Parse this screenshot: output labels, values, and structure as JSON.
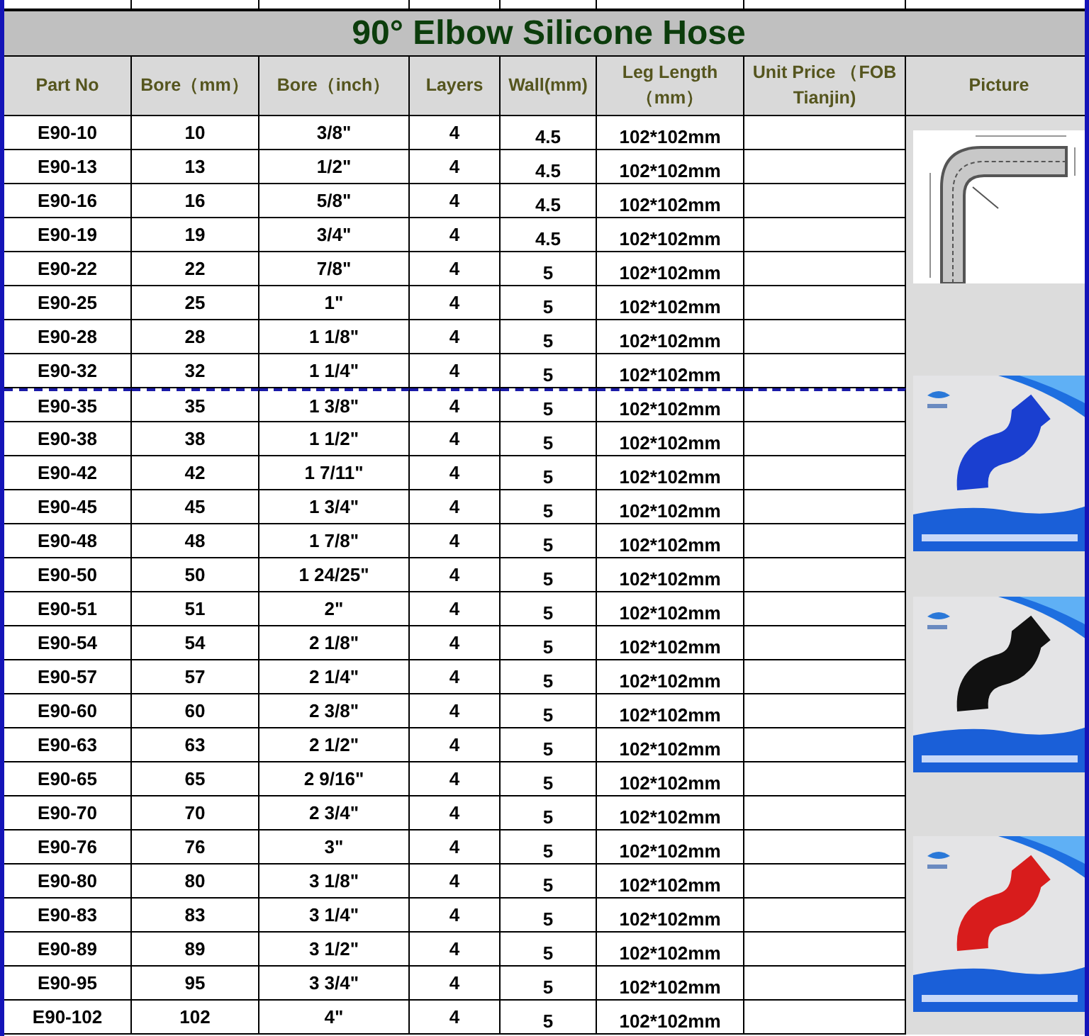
{
  "title": "90° Elbow Silicone Hose",
  "columns": [
    "Part No",
    "Bore（mm）",
    "Bore（inch）",
    "Layers",
    "Wall(mm)",
    "Leg Length（mm）",
    "Unit Price （FOB Tianjin)",
    "Picture"
  ],
  "rows": [
    {
      "page_break": false,
      "part_no": "E90-10",
      "bore_mm": "10",
      "bore_inch": "3/8\"",
      "layers": "4",
      "wall_mm": "4.5",
      "leg_length": "102*102mm"
    },
    {
      "page_break": false,
      "part_no": "E90-13",
      "bore_mm": "13",
      "bore_inch": "1/2\"",
      "layers": "4",
      "wall_mm": "4.5",
      "leg_length": "102*102mm"
    },
    {
      "page_break": false,
      "part_no": "E90-16",
      "bore_mm": "16",
      "bore_inch": "5/8\"",
      "layers": "4",
      "wall_mm": "4.5",
      "leg_length": "102*102mm"
    },
    {
      "page_break": false,
      "part_no": "E90-19",
      "bore_mm": "19",
      "bore_inch": "3/4\"",
      "layers": "4",
      "wall_mm": "4.5",
      "leg_length": "102*102mm"
    },
    {
      "page_break": false,
      "part_no": "E90-22",
      "bore_mm": "22",
      "bore_inch": "7/8\"",
      "layers": "4",
      "wall_mm": "5",
      "leg_length": "102*102mm"
    },
    {
      "page_break": false,
      "part_no": "E90-25",
      "bore_mm": "25",
      "bore_inch": "1\"",
      "layers": "4",
      "wall_mm": "5",
      "leg_length": "102*102mm"
    },
    {
      "page_break": false,
      "part_no": "E90-28",
      "bore_mm": "28",
      "bore_inch": "1 1/8\"",
      "layers": "4",
      "wall_mm": "5",
      "leg_length": "102*102mm"
    },
    {
      "page_break": false,
      "part_no": "E90-32",
      "bore_mm": "32",
      "bore_inch": "1 1/4\"",
      "layers": "4",
      "wall_mm": "5",
      "leg_length": "102*102mm"
    },
    {
      "page_break": true,
      "part_no": "E90-35",
      "bore_mm": "35",
      "bore_inch": "1 3/8\"",
      "layers": "4",
      "wall_mm": "5",
      "leg_length": "102*102mm"
    },
    {
      "page_break": false,
      "part_no": "E90-38",
      "bore_mm": "38",
      "bore_inch": "1 1/2\"",
      "layers": "4",
      "wall_mm": "5",
      "leg_length": "102*102mm"
    },
    {
      "page_break": false,
      "part_no": "E90-42",
      "bore_mm": "42",
      "bore_inch": "1 7/11\"",
      "layers": "4",
      "wall_mm": "5",
      "leg_length": "102*102mm"
    },
    {
      "page_break": false,
      "part_no": "E90-45",
      "bore_mm": "45",
      "bore_inch": "1 3/4\"",
      "layers": "4",
      "wall_mm": "5",
      "leg_length": "102*102mm"
    },
    {
      "page_break": false,
      "part_no": "E90-48",
      "bore_mm": "48",
      "bore_inch": "1 7/8\"",
      "layers": "4",
      "wall_mm": "5",
      "leg_length": "102*102mm"
    },
    {
      "page_break": false,
      "part_no": "E90-50",
      "bore_mm": "50",
      "bore_inch": "1 24/25\"",
      "layers": "4",
      "wall_mm": "5",
      "leg_length": "102*102mm"
    },
    {
      "page_break": false,
      "part_no": "E90-51",
      "bore_mm": "51",
      "bore_inch": "2\"",
      "layers": "4",
      "wall_mm": "5",
      "leg_length": "102*102mm"
    },
    {
      "page_break": false,
      "part_no": "E90-54",
      "bore_mm": "54",
      "bore_inch": "2 1/8\"",
      "layers": "4",
      "wall_mm": "5",
      "leg_length": "102*102mm"
    },
    {
      "page_break": false,
      "part_no": "E90-57",
      "bore_mm": "57",
      "bore_inch": "2 1/4\"",
      "layers": "4",
      "wall_mm": "5",
      "leg_length": "102*102mm"
    },
    {
      "page_break": false,
      "part_no": "E90-60",
      "bore_mm": "60",
      "bore_inch": "2 3/8\"",
      "layers": "4",
      "wall_mm": "5",
      "leg_length": "102*102mm"
    },
    {
      "page_break": false,
      "part_no": "E90-63",
      "bore_mm": "63",
      "bore_inch": "2 1/2\"",
      "layers": "4",
      "wall_mm": "5",
      "leg_length": "102*102mm"
    },
    {
      "page_break": false,
      "part_no": "E90-65",
      "bore_mm": "65",
      "bore_inch": "2 9/16\"",
      "layers": "4",
      "wall_mm": "5",
      "leg_length": "102*102mm"
    },
    {
      "page_break": false,
      "part_no": "E90-70",
      "bore_mm": "70",
      "bore_inch": "2 3/4\"",
      "layers": "4",
      "wall_mm": "5",
      "leg_length": "102*102mm"
    },
    {
      "page_break": false,
      "part_no": "E90-76",
      "bore_mm": "76",
      "bore_inch": "3\"",
      "layers": "4",
      "wall_mm": "5",
      "leg_length": "102*102mm"
    },
    {
      "page_break": false,
      "part_no": "E90-80",
      "bore_mm": "80",
      "bore_inch": "3 1/8\"",
      "layers": "4",
      "wall_mm": "5",
      "leg_length": "102*102mm"
    },
    {
      "page_break": false,
      "part_no": "E90-83",
      "bore_mm": "83",
      "bore_inch": "3 1/4\"",
      "layers": "4",
      "wall_mm": "5",
      "leg_length": "102*102mm"
    },
    {
      "page_break": false,
      "part_no": "E90-89",
      "bore_mm": "89",
      "bore_inch": "3 1/2\"",
      "layers": "4",
      "wall_mm": "5",
      "leg_length": "102*102mm"
    },
    {
      "page_break": false,
      "part_no": "E90-95",
      "bore_mm": "95",
      "bore_inch": "3 3/4\"",
      "layers": "4",
      "wall_mm": "5",
      "leg_length": "102*102mm"
    },
    {
      "page_break": false,
      "part_no": "E90-102",
      "bore_mm": "102",
      "bore_inch": "4\"",
      "layers": "4",
      "wall_mm": "5",
      "leg_length": "102*102mm"
    }
  ],
  "pictures": [
    {
      "kind": "diagram"
    },
    {
      "kind": "picture"
    },
    {
      "kind": "picture"
    },
    {
      "kind": "picture"
    }
  ]
}
